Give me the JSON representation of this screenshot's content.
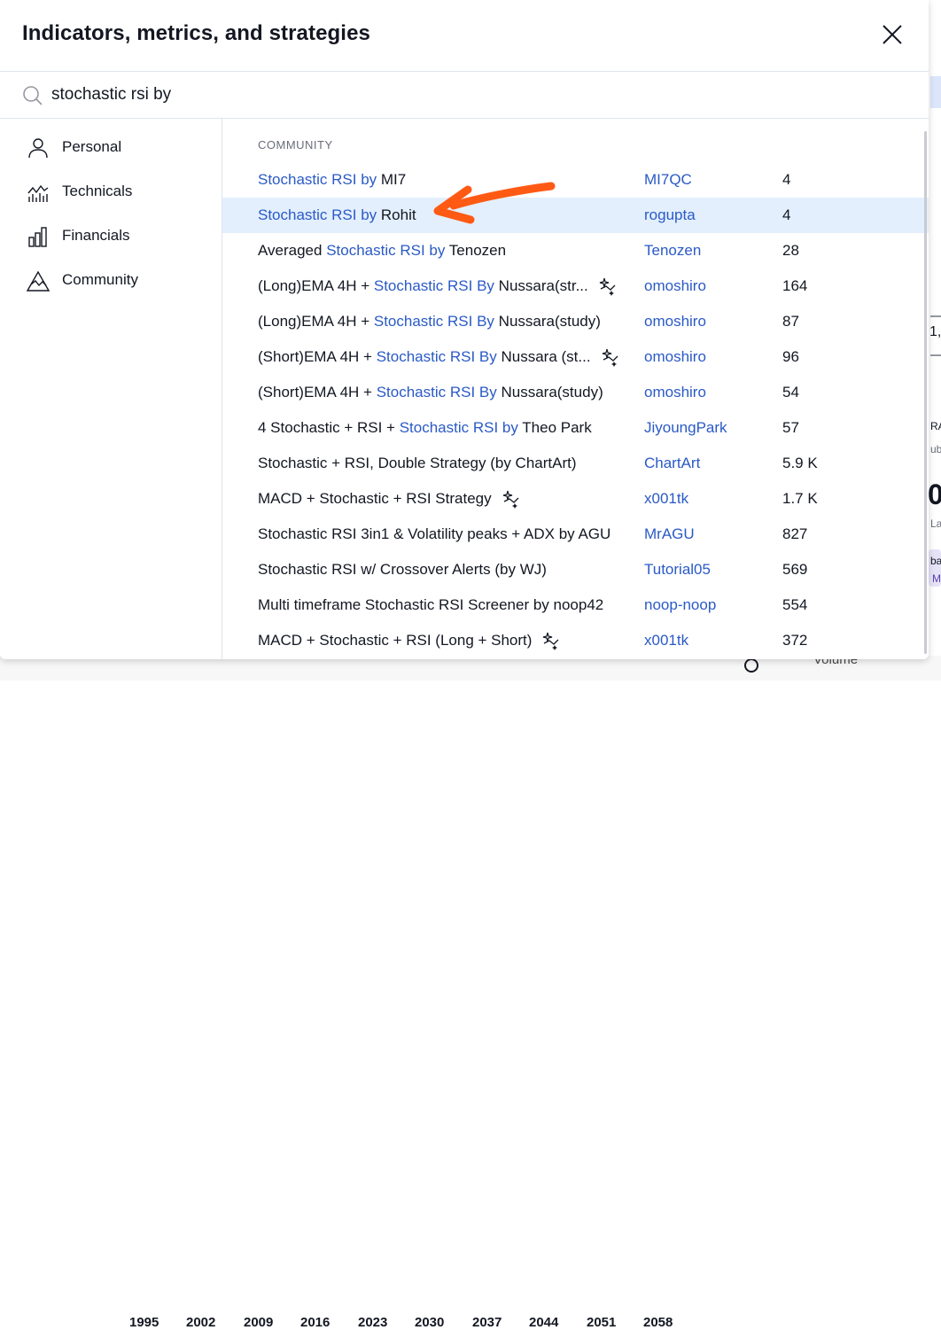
{
  "dialog": {
    "title": "Indicators, metrics, and strategies"
  },
  "search": {
    "value": "stochastic rsi by"
  },
  "sidebar": {
    "items": [
      {
        "label": "Personal",
        "icon": "person-icon"
      },
      {
        "label": "Technicals",
        "icon": "technicals-chart-icon"
      },
      {
        "label": "Financials",
        "icon": "financials-bars-icon"
      },
      {
        "label": "Community",
        "icon": "community-mountain-icon"
      }
    ]
  },
  "results": {
    "section_label": "COMMUNITY",
    "rows": [
      {
        "pre": "",
        "hl": "Stochastic RSI by",
        "post": " MI7",
        "author": "MI7QC",
        "count": "4",
        "strategy": false
      },
      {
        "pre": "",
        "hl": "Stochastic RSI by",
        "post": " Rohit",
        "author": "rogupta",
        "count": "4",
        "strategy": false
      },
      {
        "pre": "Averaged ",
        "hl": "Stochastic RSI by",
        "post": " Tenozen",
        "author": "Tenozen",
        "count": "28",
        "strategy": false
      },
      {
        "pre": "(Long)EMA 4H + ",
        "hl": "Stochastic RSI By",
        "post": " Nussara(str...",
        "author": "omoshiro",
        "count": "164",
        "strategy": true
      },
      {
        "pre": "(Long)EMA 4H + ",
        "hl": "Stochastic RSI By",
        "post": " Nussara(study)",
        "author": "omoshiro",
        "count": "87",
        "strategy": false
      },
      {
        "pre": "(Short)EMA 4H + ",
        "hl": "Stochastic RSI By",
        "post": " Nussara (st...",
        "author": "omoshiro",
        "count": "96",
        "strategy": true
      },
      {
        "pre": "(Short)EMA 4H + ",
        "hl": "Stochastic RSI By",
        "post": " Nussara(study)",
        "author": "omoshiro",
        "count": "54",
        "strategy": false
      },
      {
        "pre": "4 Stochastic + RSI + ",
        "hl": "Stochastic RSI by",
        "post": " Theo Park",
        "author": "JiyoungPark",
        "count": "57",
        "strategy": false
      },
      {
        "pre": "Stochastic + RSI, Double Strategy (by ChartArt)",
        "hl": "",
        "post": "",
        "author": "ChartArt",
        "count": "5.9 K",
        "strategy": false
      },
      {
        "pre": "MACD + Stochastic + RSI Strategy",
        "hl": "",
        "post": "",
        "author": "x001tk",
        "count": "1.7 K",
        "strategy": true
      },
      {
        "pre": "Stochastic RSI 3in1 & Volatility peaks + ADX by AGU",
        "hl": "",
        "post": "",
        "author": "MrAGU",
        "count": "827",
        "strategy": false
      },
      {
        "pre": "Stochastic RSI w/ Crossover Alerts (by WJ)",
        "hl": "",
        "post": "",
        "author": "Tutorial05",
        "count": "569",
        "strategy": false
      },
      {
        "pre": "Multi timeframe Stochastic RSI Screener by noop42",
        "hl": "",
        "post": "",
        "author": "noop-noop",
        "count": "554",
        "strategy": false
      },
      {
        "pre": "MACD + Stochastic + RSI (Long + Short)",
        "hl": "",
        "post": "",
        "author": "x001tk",
        "count": "372",
        "strategy": true
      }
    ]
  },
  "background": {
    "years": [
      "1995",
      "2002",
      "2009",
      "2016",
      "2023",
      "2030",
      "2037",
      "2044",
      "2051",
      "2058"
    ],
    "volume_label": "Volume",
    "fragments": [
      "1,",
      "RA",
      "ubl",
      "0",
      "La",
      "ba",
      "M"
    ]
  },
  "colors": {
    "accent": "#2a5ac6",
    "highlight_row": "#e3effd",
    "annotation_arrow": "#ff5a14"
  }
}
